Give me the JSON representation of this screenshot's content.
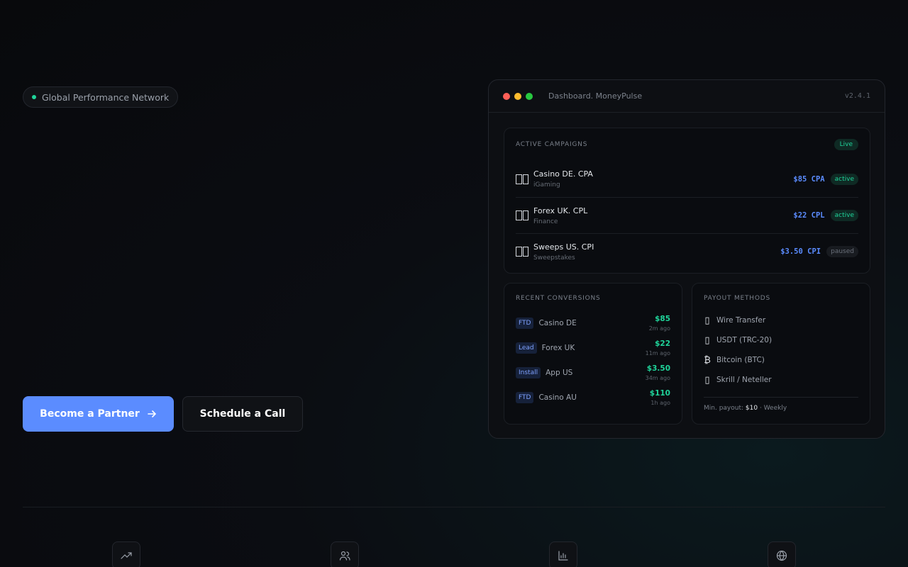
{
  "badge": {
    "label": "Global Performance Network"
  },
  "cta": {
    "primary": "Become a Partner",
    "secondary": "Schedule a Call"
  },
  "dashboard": {
    "title": "Dashboard. MoneyPulse",
    "version": "v2.4.1",
    "campaigns": {
      "heading": "ACTIVE CAMPAIGNS",
      "status": "Live",
      "items": [
        {
          "name": "Casino DE. CPA",
          "category": "iGaming",
          "price": "$85 CPA",
          "status": "active"
        },
        {
          "name": "Forex UK. CPL",
          "category": "Finance",
          "price": "$22 CPL",
          "status": "active"
        },
        {
          "name": "Sweeps US. CPI",
          "category": "Sweepstakes",
          "price": "$3.50 CPI",
          "status": "paused"
        }
      ]
    },
    "conversions": {
      "heading": "RECENT CONVERSIONS",
      "items": [
        {
          "tag": "FTD",
          "name": "Casino DE",
          "amount": "$85",
          "time": "2m ago"
        },
        {
          "tag": "Lead",
          "name": "Forex UK",
          "amount": "$22",
          "time": "11m ago"
        },
        {
          "tag": "Install",
          "name": "App US",
          "amount": "$3.50",
          "time": "34m ago"
        },
        {
          "tag": "FTD",
          "name": "Casino AU",
          "amount": "$110",
          "time": "1h ago"
        }
      ]
    },
    "payouts": {
      "heading": "PAYOUT METHODS",
      "items": [
        {
          "icon": "bank-icon",
          "label": "Wire Transfer"
        },
        {
          "icon": "usdt-icon",
          "label": "USDT (TRC-20)"
        },
        {
          "icon": "bitcoin-icon",
          "label": "Bitcoin (BTC)"
        },
        {
          "icon": "wallet-icon",
          "label": "Skrill / Neteller"
        }
      ],
      "footer_prefix": "Min. payout:",
      "footer_amount": "$10",
      "footer_suffix": "· Weekly"
    }
  },
  "features": [
    {
      "icon": "trending-up-icon"
    },
    {
      "icon": "users-icon"
    },
    {
      "icon": "bar-chart-icon"
    },
    {
      "icon": "globe-icon"
    }
  ],
  "colors": {
    "accent": "#5b8cff",
    "success": "#1fd49a",
    "background": "#0b0d12"
  }
}
